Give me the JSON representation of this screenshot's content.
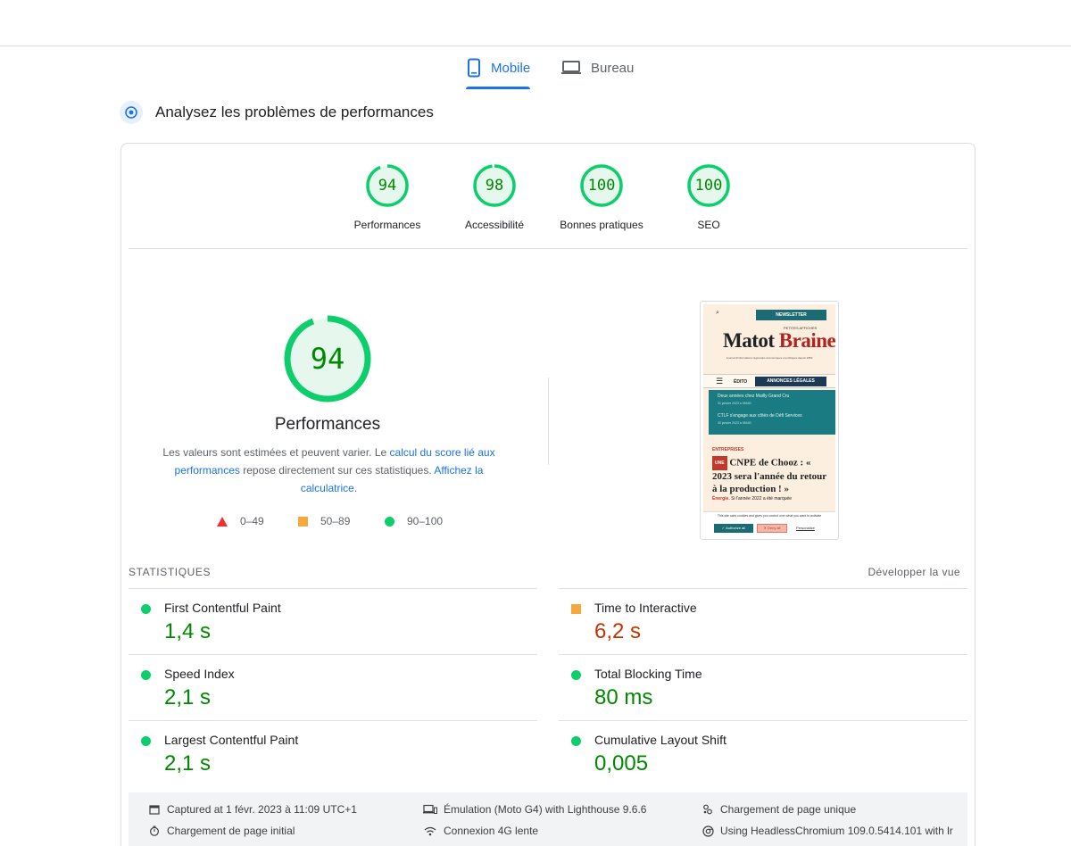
{
  "tabs": [
    {
      "label": "Mobile",
      "icon": "smartphone-icon",
      "active": true
    },
    {
      "label": "Bureau",
      "icon": "laptop-icon",
      "active": false
    }
  ],
  "section": {
    "title": "Analysez les problèmes de performances",
    "icon": "diagnose-icon"
  },
  "categories": [
    {
      "score": "94",
      "label": "Performances"
    },
    {
      "score": "98",
      "label": "Accessibilité"
    },
    {
      "score": "100",
      "label": "Bonnes pratiques"
    },
    {
      "score": "100",
      "label": "SEO"
    }
  ],
  "main": {
    "score": "94",
    "title": "Performances",
    "desc_1": "Les valeurs sont estimées et peuvent varier. Le ",
    "link_1": "calcul du score lié aux performances",
    "desc_2": " repose directement sur ces statistiques. ",
    "link_2": "Affichez la calculatrice",
    "desc_3": "."
  },
  "legend": [
    {
      "range": "0–49",
      "shape": "triangle",
      "color": "#ff3333"
    },
    {
      "range": "50–89",
      "shape": "square",
      "color": "#ffaa33"
    },
    {
      "range": "90–100",
      "shape": "circle",
      "color": "#0cce6b"
    }
  ],
  "screenshot": {
    "newsletter": "NEWSLETTER",
    "petites": "PETITES AFFICHES",
    "logo_a": "Matot",
    "logo_b": "Braine",
    "tagline": "Journal d'informations régionales économiques et juridiques depuis 1882",
    "nav_edito": "ÉDITO",
    "nav_annonces": "ANNONCES LÉGALES",
    "item_1": "Deux années chez Mailly Grand Cru",
    "item_1_date": "31 janvier 2023 à 08h30",
    "item_2": "CTLF s'engage aux côtés de Défi Services",
    "item_2_date": "30 janvier 2023 à 08h30",
    "section": "ENTREPRISES",
    "une": "UNE",
    "headline": " CNPE de Chooz : « 2023 sera l'année du retour à la production ! »",
    "kicker": "Énergie.",
    "lead": " Si l'année 2022 a été marquée",
    "cookie_text": "This site uses cookies and gives you control over what you want to activate",
    "authorize": "✓ Authorize all",
    "deny": "✕ Deny all",
    "personalize": "Personalize"
  },
  "statistics": {
    "heading": "STATISTIQUES",
    "expand": "Développer la vue",
    "metrics": [
      {
        "name": "First Contentful Paint",
        "value": "1,4 s",
        "rating": "good"
      },
      {
        "name": "Time to Interactive",
        "value": "6,2 s",
        "rating": "average"
      },
      {
        "name": "Speed Index",
        "value": "2,1 s",
        "rating": "good"
      },
      {
        "name": "Total Blocking Time",
        "value": "80 ms",
        "rating": "good"
      },
      {
        "name": "Largest Contentful Paint",
        "value": "2,1 s",
        "rating": "good"
      },
      {
        "name": "Cumulative Layout Shift",
        "value": "0,005",
        "rating": "good"
      }
    ]
  },
  "footer": {
    "captured": "Captured at 1 févr. 2023 à 11:09 UTC+1",
    "emulation": "Émulation (Moto G4) with Lighthouse 9.6.6",
    "single_load": "Chargement de page unique",
    "initial_load": "Chargement de page initial",
    "connection": "Connexion 4G lente",
    "browser": "Using HeadlessChromium 109.0.5414.101 with lr"
  },
  "colors": {
    "accent": "#1a73e8",
    "good": "#0cce6b",
    "good_text": "#008800",
    "average": "#ffa400",
    "average_text": "#c33300"
  }
}
